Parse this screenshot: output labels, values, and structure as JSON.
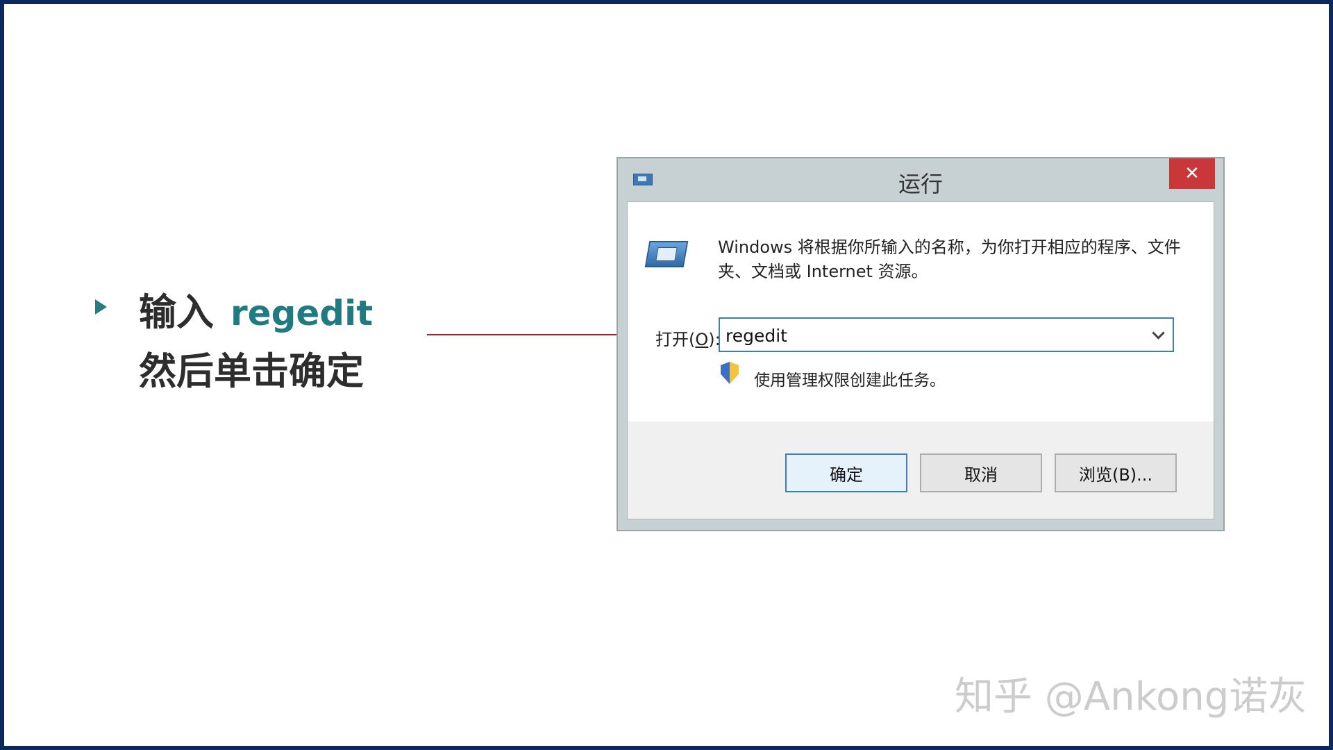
{
  "instruction": {
    "line1_prefix": "输入",
    "line1_keyword": "regedit",
    "line2": "然后单击确定"
  },
  "dialog": {
    "title": "运行",
    "close_glyph": "✕",
    "description": "Windows 将根据你所输入的名称，为你打开相应的程序、文件夹、文档或 Internet 资源。",
    "open_label_prefix": "打开(",
    "open_label_key": "O",
    "open_label_suffix": "):",
    "input_value": "regedit",
    "admin_text": "使用管理权限创建此任务。",
    "buttons": {
      "ok": "确定",
      "cancel": "取消",
      "browse": "浏览(B)..."
    },
    "icons": [
      "run-app-icon",
      "run-large-icon",
      "uac-shield-icon",
      "chevron-down-icon"
    ]
  },
  "watermark": "知乎 @Ankong诺灰",
  "colors": {
    "frame": "#0b2a5b",
    "accent_teal": "#1f7a82",
    "pointer_red": "#b21f2d",
    "close_red": "#c9373a",
    "focus_blue": "#3c7fb1"
  }
}
